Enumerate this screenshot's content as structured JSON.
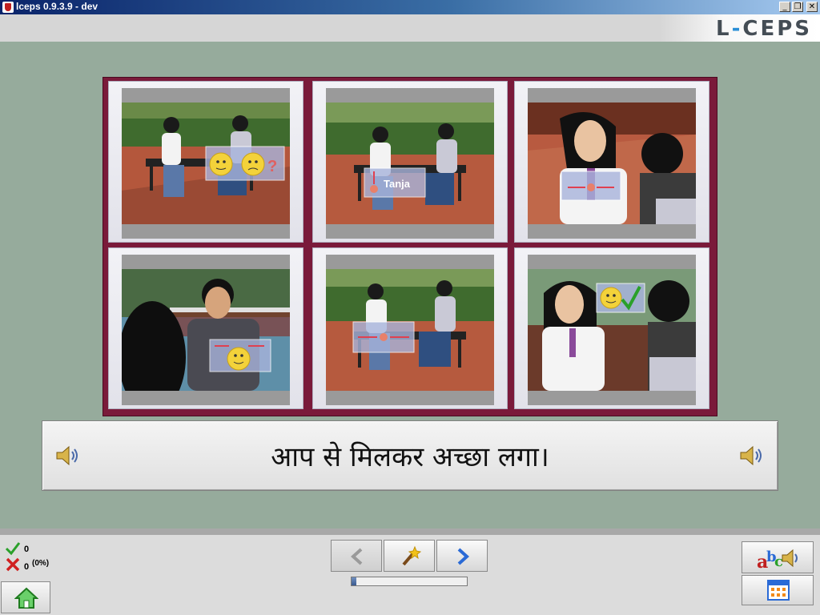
{
  "window": {
    "title": "lceps 0.9.3.9 - dev",
    "controls": [
      "minimize-icon",
      "restore-icon",
      "close-icon"
    ]
  },
  "header": {
    "logo_left": "L",
    "logo_dash": "-",
    "logo_right": "CEPS"
  },
  "images": [
    {
      "scene": "bench-two-people",
      "overlay": "smiley-confused-question",
      "caption": ""
    },
    {
      "scene": "bench-two-people",
      "overlay": "name-tag",
      "caption": "Tanja"
    },
    {
      "scene": "woman-closeup",
      "overlay": "pointing-self",
      "caption": ""
    },
    {
      "scene": "man-closeup",
      "overlay": "pointing-self-smiley",
      "caption": ""
    },
    {
      "scene": "bench-two-people",
      "overlay": "arrows-both-ways",
      "caption": ""
    },
    {
      "scene": "woman-smiling",
      "overlay": "smiley-checkmark",
      "caption": ""
    }
  ],
  "sentence": {
    "text": "आप से मिलकर अच्छा लगा।",
    "left_audio_icon": "speaker-icon",
    "right_audio_icon": "speaker-icon"
  },
  "stats": {
    "correct": "0",
    "wrong": "0",
    "percent": "(0%)"
  },
  "navigation": {
    "prev_icon": "arrow-left-icon",
    "hint_icon": "magic-wand-icon",
    "next_icon": "arrow-right-icon",
    "progress": 0.04
  },
  "right_tools": {
    "pronunciation_icon": "abc-speaker-icon",
    "grid_icon": "calendar-grid-icon"
  },
  "colors": {
    "background": "#96ab9c",
    "frame": "#7a1a3a",
    "accent": "#2a8fd6"
  }
}
